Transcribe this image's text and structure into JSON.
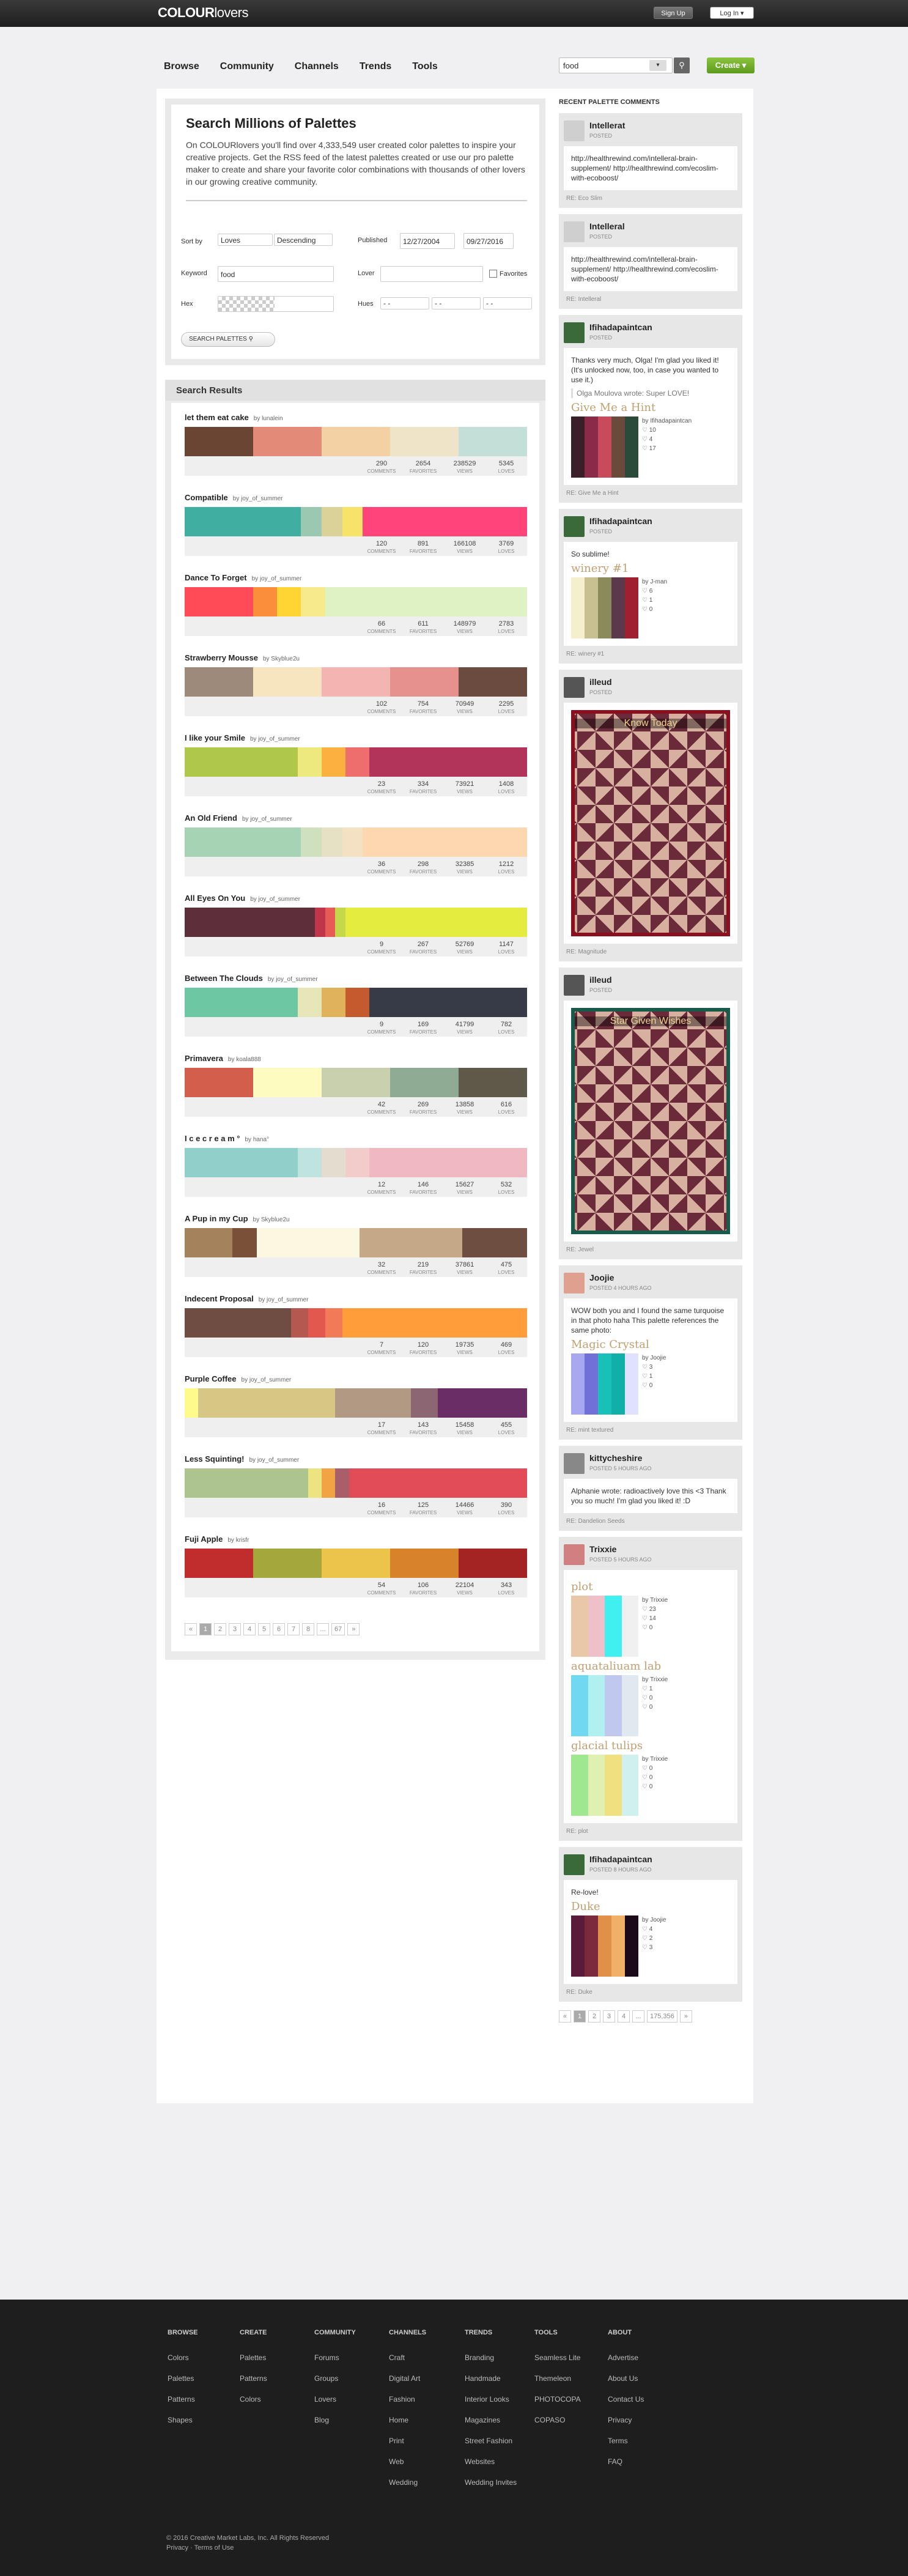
{
  "header": {
    "logo_a": "COLOUR",
    "logo_b": "lovers",
    "signup": "Sign Up",
    "login": "Log In ▾"
  },
  "nav": {
    "items": [
      "Browse",
      "Community",
      "Channels",
      "Trends",
      "Tools"
    ],
    "search_value": "food",
    "search_select": "▾",
    "create": "Create ▾"
  },
  "intro": {
    "title": "Search Millions of Palettes",
    "text": "On COLOURlovers you'll find over 4,333,549 user created color palettes to inspire your creative projects. Get the RSS feed of the latest palettes created or use our pro palette maker to create and share your favorite color combinations with thousands of other lovers in our growing creative community.",
    "sort_label": "Sort by",
    "sort_value": "Loves",
    "order_value": "Descending",
    "published_label": "Published",
    "date_from": "12/27/2004",
    "date_to": "09/27/2016",
    "keyword_label": "Keyword",
    "keyword_value": "food",
    "lover_label": "Lover",
    "favorites_label": "Favorites",
    "hex_label": "Hex",
    "hues_label": "Hues",
    "hue_placeholder": "- -",
    "search_button": "SEARCH PALETTES"
  },
  "results": {
    "heading": "Search Results",
    "labels": {
      "comments": "COMMENTS",
      "favorites": "FAVORITES",
      "views": "VIEWS",
      "loves": "LOVES"
    },
    "palettes": [
      {
        "title": "let them eat cake",
        "by": "by lunalein",
        "colors": [
          "#6b4533",
          "#e38a78",
          "#f3d1a5",
          "#efe3c8",
          "#c2e0d7"
        ],
        "widths": [
          20,
          20,
          20,
          20,
          20
        ],
        "comments": "290",
        "favorites": "2654",
        "views": "238529",
        "loves": "5345"
      },
      {
        "title": "Compatible",
        "by": "by joy_of_summer",
        "colors": [
          "#40aea0",
          "#9ac8b0",
          "#dbd29a",
          "#f7e36a",
          "#ff4479"
        ],
        "widths": [
          34,
          6,
          6,
          6,
          48
        ],
        "comments": "120",
        "favorites": "891",
        "views": "166108",
        "loves": "3769"
      },
      {
        "title": "Dance To Forget",
        "by": "by joy_of_summer",
        "colors": [
          "#ff4a57",
          "#fa8e3b",
          "#ffd534",
          "#f5eb8c",
          "#dff2c3"
        ],
        "widths": [
          20,
          7,
          7,
          7,
          59
        ],
        "comments": "66",
        "favorites": "611",
        "views": "148979",
        "loves": "2783"
      },
      {
        "title": "Strawberry Mousse",
        "by": "by Skyblue2u",
        "colors": [
          "#9d8a7a",
          "#f7e5c0",
          "#f2b5b2",
          "#e6918e",
          "#6b4b40"
        ],
        "widths": [
          20,
          20,
          20,
          20,
          20
        ],
        "comments": "102",
        "favorites": "754",
        "views": "70949",
        "loves": "2295"
      },
      {
        "title": "I like your Smile",
        "by": "by joy_of_summer",
        "colors": [
          "#b0c84a",
          "#ede97e",
          "#fbb040",
          "#ee6e6e",
          "#b2345a"
        ],
        "widths": [
          33,
          7,
          7,
          7,
          46
        ],
        "comments": "23",
        "favorites": "334",
        "views": "73921",
        "loves": "1408"
      },
      {
        "title": "An Old Friend",
        "by": "by joy_of_summer",
        "colors": [
          "#a6d3b3",
          "#cfe0be",
          "#e6e0c4",
          "#f4e0c2",
          "#fdd7b0"
        ],
        "widths": [
          34,
          6,
          6,
          6,
          48
        ],
        "comments": "36",
        "favorites": "298",
        "views": "32385",
        "loves": "1212"
      },
      {
        "title": "All Eyes On You",
        "by": "by joy_of_summer",
        "colors": [
          "#5c2f3b",
          "#c0354a",
          "#e85a56",
          "#c4d84a",
          "#e5ec40"
        ],
        "widths": [
          38,
          3,
          3,
          3,
          53
        ],
        "comments": "9",
        "favorites": "267",
        "views": "52769",
        "loves": "1147"
      },
      {
        "title": "Between The Clouds",
        "by": "by joy_of_summer",
        "colors": [
          "#6dc7a2",
          "#e7e6b8",
          "#e0b25c",
          "#c45a2e",
          "#363b47"
        ],
        "widths": [
          33,
          7,
          7,
          7,
          46
        ],
        "comments": "9",
        "favorites": "169",
        "views": "41799",
        "loves": "782"
      },
      {
        "title": "Primavera",
        "by": "by koala888",
        "colors": [
          "#d35e4b",
          "#fdfbc0",
          "#c8d0ae",
          "#8fab93",
          "#5f5949"
        ],
        "widths": [
          20,
          20,
          20,
          20,
          20
        ],
        "comments": "42",
        "favorites": "269",
        "views": "13858",
        "loves": "616"
      },
      {
        "title": "I c e c r e a m °",
        "by": "by hana°",
        "colors": [
          "#8fd0cb",
          "#bfe3de",
          "#e5dcd0",
          "#f1cccb",
          "#f0b8c0"
        ],
        "widths": [
          33,
          7,
          7,
          7,
          46
        ],
        "comments": "12",
        "favorites": "146",
        "views": "15627",
        "loves": "532"
      },
      {
        "title": "A Pup in my Cup",
        "by": "by Skyblue2u",
        "colors": [
          "#a4825c",
          "#7a5038",
          "#fcf7e0",
          "#c4a888",
          "#6d4e40"
        ],
        "widths": [
          14,
          7,
          30,
          30,
          19
        ],
        "comments": "32",
        "favorites": "219",
        "views": "37861",
        "loves": "475"
      },
      {
        "title": "Indecent Proposal",
        "by": "by joy_of_summer",
        "colors": [
          "#6f4d42",
          "#b45850",
          "#e2574e",
          "#f27a58",
          "#ff9d3b"
        ],
        "widths": [
          31,
          5,
          5,
          5,
          54
        ],
        "comments": "7",
        "favorites": "120",
        "views": "19735",
        "loves": "469"
      },
      {
        "title": "Purple Coffee",
        "by": "by joy_of_summer",
        "colors": [
          "#fefb8c",
          "#d6c784",
          "#b29983",
          "#8c6672",
          "#6a2d66"
        ],
        "widths": [
          4,
          40,
          22,
          8,
          26
        ],
        "comments": "17",
        "favorites": "143",
        "views": "15458",
        "loves": "455"
      },
      {
        "title": "Less Squinting!",
        "by": "by joy_of_summer",
        "colors": [
          "#aec48e",
          "#ebe480",
          "#f2a445",
          "#a85f6a",
          "#e14c58"
        ],
        "widths": [
          36,
          4,
          4,
          4,
          52
        ],
        "comments": "16",
        "favorites": "125",
        "views": "14466",
        "loves": "390"
      },
      {
        "title": "Fuji Apple",
        "by": "by krisfr",
        "colors": [
          "#c12c2c",
          "#a4a73c",
          "#ecc44a",
          "#d6832a",
          "#a42424"
        ],
        "widths": [
          20,
          20,
          20,
          20,
          20
        ],
        "comments": "54",
        "favorites": "106",
        "views": "22104",
        "loves": "343"
      }
    ],
    "pager": [
      "«",
      "1",
      "2",
      "3",
      "4",
      "5",
      "6",
      "7",
      "8",
      "...",
      "67",
      "»"
    ]
  },
  "side": {
    "heading": "RECENT PALETTE COMMENTS",
    "comments": [
      {
        "user": "Intellerat",
        "posted": "POSTED",
        "text": "http://healthrewind.com/intelleral-brain-supplement/ http://healthrewind.com/ecoslim-with-ecoboost/",
        "re": "RE: Eco Slim",
        "avatar": "#cfcfcf"
      },
      {
        "user": "Intelleral",
        "posted": "POSTED",
        "text": "http://healthrewind.com/intelleral-brain-supplement/ http://healthrewind.com/ecoslim-with-ecoboost/",
        "re": "RE: Intelleral",
        "avatar": "#cfcfcf"
      },
      {
        "user": "Ifihadapaintcan",
        "posted": "POSTED",
        "text": "Thanks very much, Olga! I'm glad you liked it! (It's unlocked now, too, in case you wanted to use it.)",
        "quote": "Olga Moulova wrote: Super LOVE!",
        "mini_title": "Give Me a Hint",
        "mini_by": "by Ifihadapaintcan",
        "mini_stats": [
          "10",
          "4",
          "17"
        ],
        "mini_colors": [
          "#3a1f2a",
          "#8c2a4a",
          "#c94a5a",
          "#6a4a3a",
          "#2a4a3a"
        ],
        "re": "RE: Give Me a Hint",
        "avatar": "#3a6a3a"
      },
      {
        "user": "Ifihadapaintcan",
        "posted": "POSTED",
        "text": "So sublime!",
        "mini_title": "winery #1",
        "mini_by": "by J-man",
        "mini_stats": [
          "6",
          "1",
          "0"
        ],
        "mini_colors": [
          "#f5efcc",
          "#c8c090",
          "#8a8a5a",
          "#5a3a4a",
          "#a02030"
        ],
        "re": "RE: winery #1",
        "avatar": "#3a6a3a"
      },
      {
        "user": "illeud",
        "posted": "POSTED",
        "pattern_title": "Know Today",
        "re": "RE: Magnitude",
        "avatar": "#555"
      },
      {
        "user": "illeud",
        "posted": "POSTED",
        "pattern_title": "Star Given Wishes",
        "re": "RE: Jewel",
        "avatar": "#555"
      },
      {
        "user": "Joojie",
        "posted": "POSTED 4 HOURS AGO",
        "text": "WOW both you and I found the same turquoise in that photo haha This palette references the same photo:",
        "mini_title": "Magic Crystal",
        "mini_by": "by Joojie",
        "mini_stats": [
          "3",
          "1",
          "0"
        ],
        "mini_colors": [
          "#a8a8f0",
          "#7070d8",
          "#18c0b8",
          "#10b0a8",
          "#e0e0ff"
        ],
        "re": "RE: mint textured",
        "avatar": "#e0a090"
      },
      {
        "user": "kittycheshire",
        "posted": "POSTED 5 HOURS AGO",
        "text": "Alphanie wrote: radioactively love this <3 Thank you so much! I'm glad you liked it! :D",
        "re": "RE: Dandelion Seeds",
        "avatar": "#888"
      },
      {
        "user": "Trixxie",
        "posted": "POSTED 5 HOURS AGO",
        "minis": [
          {
            "title": "plot",
            "by": "by Trixxie",
            "stats": [
              "23",
              "14",
              "0"
            ],
            "colors": [
              "#e8c8a8",
              "#f0c0c8",
              "#40f0f0",
              "#f0f0f0"
            ]
          },
          {
            "title": "aquataliuam lab",
            "by": "by Trixxie",
            "stats": [
              "1",
              "0",
              "0"
            ],
            "colors": [
              "#70d8f0",
              "#b0f0f0",
              "#c0c8f0",
              "#e0e8f0"
            ]
          },
          {
            "title": "glacial tulips",
            "by": "by Trixxie",
            "stats": [
              "0",
              "0",
              "0"
            ],
            "colors": [
              "#a0e890",
              "#e0f0b0",
              "#f0e080",
              "#d0f0f0"
            ]
          }
        ],
        "re": "RE: plot",
        "avatar": "#d08080"
      },
      {
        "user": "Ifihadapaintcan",
        "posted": "POSTED 8 HOURS AGO",
        "text": "Re-love!",
        "mini_title": "Duke",
        "mini_by": "by Joojie",
        "mini_stats": [
          "4",
          "2",
          "3"
        ],
        "mini_colors": [
          "#5a1a3a",
          "#7a2a3a",
          "#e09048",
          "#f0b068",
          "#1a0a1a"
        ],
        "re": "RE: Duke",
        "avatar": "#3a6a3a"
      }
    ],
    "pager": [
      "«",
      "1",
      "2",
      "3",
      "4",
      "...",
      "175,356",
      "»"
    ]
  },
  "footer": {
    "cols": [
      {
        "h": "BROWSE",
        "items": [
          "Colors",
          "Palettes",
          "Patterns",
          "Shapes"
        ]
      },
      {
        "h": "CREATE",
        "items": [
          "Palettes",
          "Patterns",
          "Colors"
        ]
      },
      {
        "h": "COMMUNITY",
        "items": [
          "Forums",
          "Groups",
          "Lovers",
          "Blog"
        ]
      },
      {
        "h": "CHANNELS",
        "items": [
          "Craft",
          "Digital Art",
          "Fashion",
          "Home",
          "Print",
          "Web",
          "Wedding"
        ]
      },
      {
        "h": "TRENDS",
        "items": [
          "Branding",
          "Handmade",
          "Interior Looks",
          "Magazines",
          "Street Fashion",
          "Websites",
          "Wedding Invites"
        ]
      },
      {
        "h": "TOOLS",
        "items": [
          "Seamless Lite",
          "Themeleon",
          "PHOTOCOPA",
          "COPASO"
        ]
      },
      {
        "h": "ABOUT",
        "items": [
          "Advertise",
          "About Us",
          "Contact Us",
          "Privacy",
          "Terms",
          "FAQ"
        ]
      }
    ],
    "copyright": "© 2016 Creative Market Labs, Inc. All Rights Reserved",
    "links": "Privacy · Terms of Use"
  }
}
